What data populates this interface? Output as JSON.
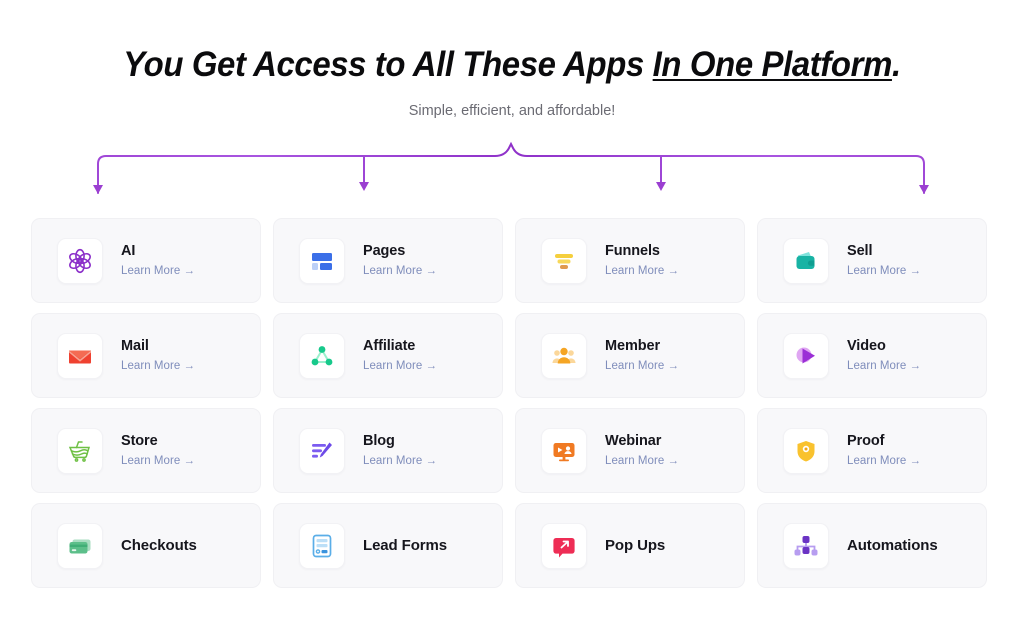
{
  "header": {
    "headline_plain": "You Get Access to All These Apps ",
    "headline_underlined": "In One Platform",
    "headline_period": ".",
    "subhead": "Simple, efficient, and affordable!"
  },
  "connector": {
    "accent_color": "#9b3fd1",
    "arrow_count": 4,
    "description": "curly-brace connector with four downward arrows"
  },
  "apps": [
    {
      "title": "AI",
      "link": "Learn More →",
      "icon": "ai-flower-icon",
      "color": "#8b2fc9"
    },
    {
      "title": "Pages",
      "link": "Learn More →",
      "icon": "pages-layout-icon",
      "color": "#3b6fe8"
    },
    {
      "title": "Funnels",
      "link": "Learn More →",
      "icon": "funnel-icon",
      "color": "#f5cf3d"
    },
    {
      "title": "Sell",
      "link": "Learn More →",
      "icon": "wallet-icon",
      "color": "#18b3a4"
    },
    {
      "title": "Mail",
      "link": "Learn More →",
      "icon": "envelope-icon",
      "color": "#ef4130"
    },
    {
      "title": "Affiliate",
      "link": "Learn More →",
      "icon": "share-network-icon",
      "color": "#17c98b"
    },
    {
      "title": "Member",
      "link": "Learn More →",
      "icon": "people-group-icon",
      "color": "#f5a524"
    },
    {
      "title": "Video",
      "link": "Learn More →",
      "icon": "play-triangle-icon",
      "color": "#9b2fd6"
    },
    {
      "title": "Store",
      "link": "Learn More →",
      "icon": "shopping-cart-icon",
      "color": "#6fc045"
    },
    {
      "title": "Blog",
      "link": "Learn More →",
      "icon": "list-pen-icon",
      "color": "#7c5cf0"
    },
    {
      "title": "Webinar",
      "link": "Learn More →",
      "icon": "presentation-icon",
      "color": "#f07a23"
    },
    {
      "title": "Proof",
      "link": "Learn More →",
      "icon": "shield-badge-icon",
      "color": "#f9c22e"
    },
    {
      "title": "Checkouts",
      "link": "",
      "icon": "credit-card-icon",
      "color": "#5cbf8a"
    },
    {
      "title": "Lead Forms",
      "link": "",
      "icon": "form-document-icon",
      "color": "#5aaee8"
    },
    {
      "title": "Pop Ups",
      "link": "",
      "icon": "popup-bubble-icon",
      "color": "#ee2d55"
    },
    {
      "title": "Automations",
      "link": "",
      "icon": "flow-chart-icon",
      "color": "#6b33c4"
    }
  ],
  "colors": {
    "page_background": "#ffffff",
    "card_background": "#f8f8fa",
    "card_border": "#f0f0f3",
    "title_text": "#16161d",
    "link_text": "#7f8dbb",
    "subhead_text": "#6b6b73",
    "accent_purple": "#9b3fd1"
  }
}
